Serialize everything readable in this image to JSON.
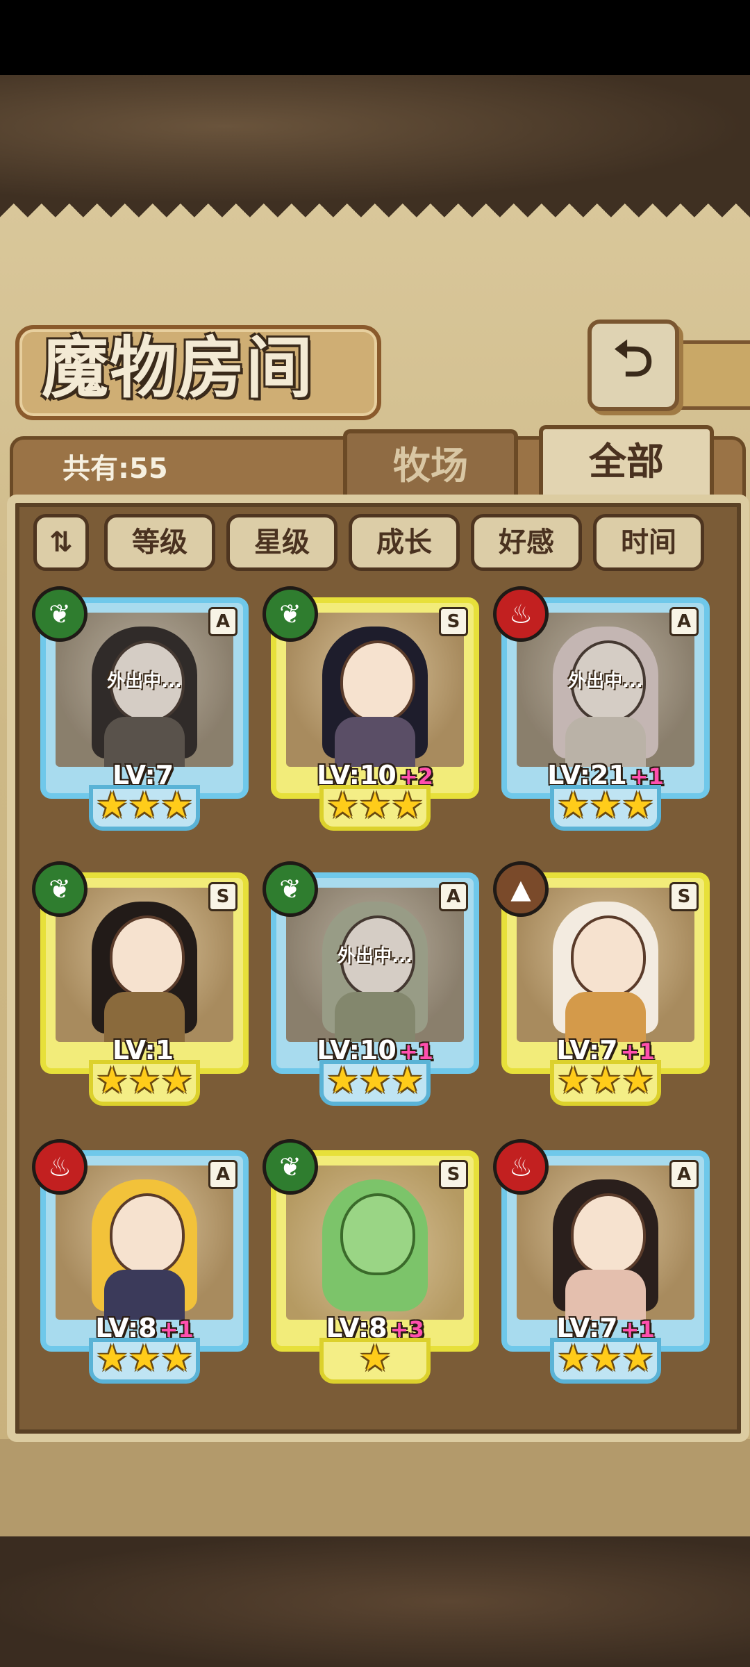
{
  "title": "魔物房间",
  "count_label": "共有:55",
  "tabs": {
    "ranch": "牧场",
    "all": "全部"
  },
  "back_glyph": "⮌",
  "sort": {
    "order_toggle": "⇅",
    "level": "等级",
    "star": "星级",
    "growth": "成长",
    "affection": "好感",
    "time": "时间"
  },
  "star_glyphs": {
    "three": "★★★",
    "one": "★"
  },
  "monsters": [
    {
      "rank": "A",
      "element": "grass",
      "level": "LV:7",
      "bonus": "",
      "stars": 3,
      "frame": "blue",
      "status": "外出中..."
    },
    {
      "rank": "S",
      "element": "grass",
      "level": "LV:10",
      "bonus": "+2",
      "stars": 3,
      "frame": "gold",
      "status": ""
    },
    {
      "rank": "A",
      "element": "fire",
      "level": "LV:21",
      "bonus": "+1",
      "stars": 3,
      "frame": "blue",
      "status": "外出中..."
    },
    {
      "rank": "S",
      "element": "grass",
      "level": "LV:1",
      "bonus": "",
      "stars": 3,
      "frame": "gold",
      "status": ""
    },
    {
      "rank": "A",
      "element": "grass",
      "level": "LV:10",
      "bonus": "+1",
      "stars": 3,
      "frame": "blue",
      "status": "外出中..."
    },
    {
      "rank": "S",
      "element": "earth",
      "level": "LV:7",
      "bonus": "+1",
      "stars": 3,
      "frame": "gold",
      "status": ""
    },
    {
      "rank": "A",
      "element": "fire",
      "level": "LV:8",
      "bonus": "+1",
      "stars": 3,
      "frame": "blue",
      "status": ""
    },
    {
      "rank": "S",
      "element": "grass",
      "level": "LV:8",
      "bonus": "+3",
      "stars": 1,
      "frame": "gold",
      "status": ""
    },
    {
      "rank": "A",
      "element": "fire",
      "level": "LV:7",
      "bonus": "+1",
      "stars": 3,
      "frame": "blue",
      "status": ""
    }
  ],
  "colors": {
    "blue_frame": "#6fc8ea",
    "gold_frame": "#e7e03a",
    "bonus": "#ff4fae",
    "grass": "#2f7d2f",
    "fire": "#c22020",
    "earth": "#7a4a2a"
  }
}
